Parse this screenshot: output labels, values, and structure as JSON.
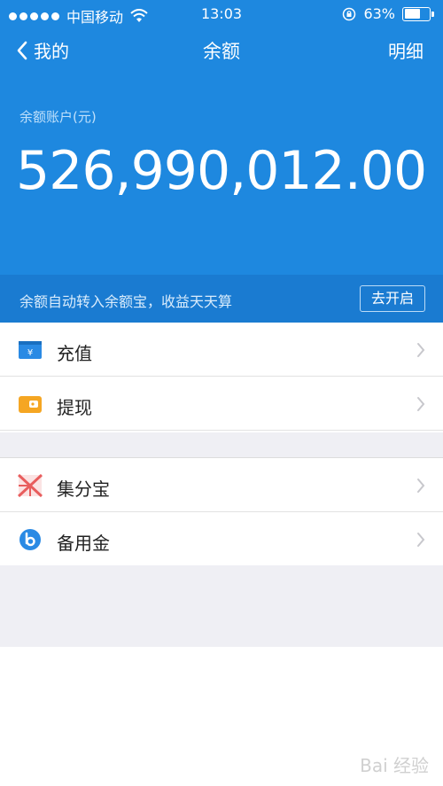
{
  "status_bar": {
    "carrier": "中国移动",
    "time": "13:03",
    "battery_percent_text": "63%",
    "battery_level": 0.63
  },
  "nav": {
    "back_label": "我的",
    "title": "余额",
    "detail_label": "明细"
  },
  "balance": {
    "label": "余额账户(元)",
    "amount": "526,990,012.00"
  },
  "promo": {
    "text": "余额自动转入余额宝，收益天天算",
    "button_label": "去开启"
  },
  "menu_group_1": [
    {
      "label": "充值",
      "icon": "recharge-icon",
      "color": "#2a8ae4"
    },
    {
      "label": "提现",
      "icon": "withdraw-icon",
      "color": "#f5a623"
    }
  ],
  "menu_group_2": [
    {
      "label": "集分宝",
      "icon": "jifenbao-icon",
      "color": "#e85d5d"
    },
    {
      "label": "备用金",
      "icon": "beiyongjin-icon",
      "color": "#2a8ae4"
    }
  ],
  "watermark": "Bai 经验",
  "colors": {
    "header_blue": "#1e88df",
    "promo_blue": "#1a7bd1",
    "background_gray": "#efeff4"
  }
}
